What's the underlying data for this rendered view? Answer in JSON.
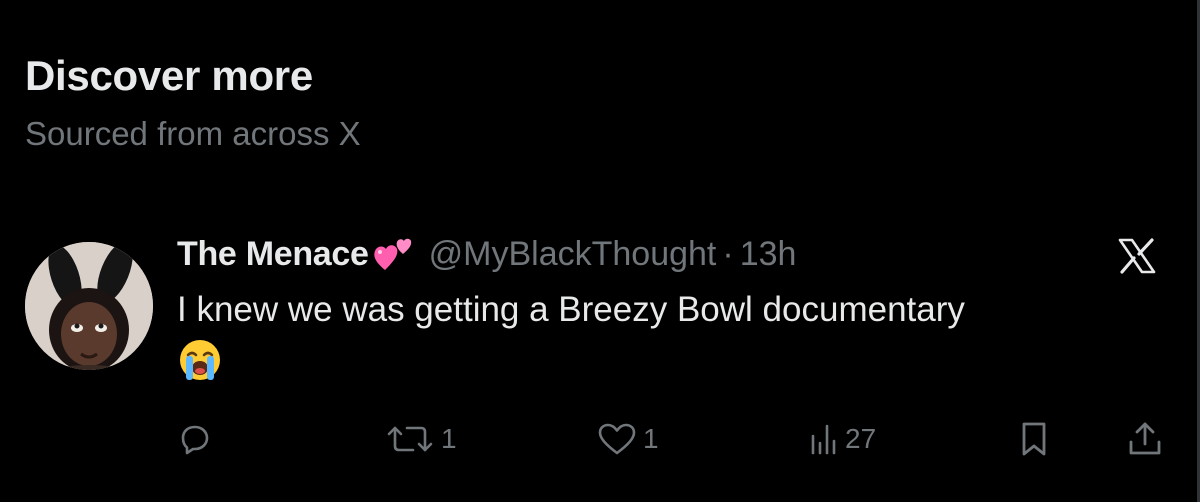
{
  "section": {
    "title": "Discover more",
    "subtitle": "Sourced from across X"
  },
  "post": {
    "author": {
      "display_name": "The Menace",
      "name_emoji": "two-hearts-emoji",
      "handle": "@MyBlackThought",
      "separator": "·",
      "time": "13h"
    },
    "text": "I knew we was getting a Breezy Bowl documentary",
    "text_emoji": "loudly-crying-face-emoji",
    "brand_icon": "x-logo-icon",
    "actions": {
      "reply_count": "",
      "repost_count": "1",
      "like_count": "1",
      "views_count": "27"
    }
  },
  "colors": {
    "background": "#000000",
    "primary_text": "#e7e9ea",
    "secondary_text": "#71767b",
    "heart_pink": "#ff6fb5"
  }
}
